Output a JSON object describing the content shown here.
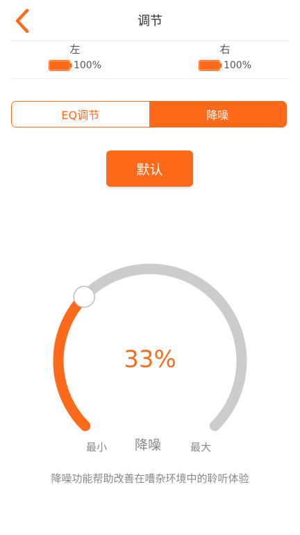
{
  "header": {
    "title": "调节"
  },
  "battery": {
    "left": {
      "side_label": "左",
      "percent_text": "100%",
      "level": 1.0
    },
    "right": {
      "side_label": "右",
      "percent_text": "100%",
      "level": 1.0
    }
  },
  "tabs": [
    {
      "label": "EQ调节",
      "active": false
    },
    {
      "label": "降噪",
      "active": true
    }
  ],
  "default_button": {
    "label": "默认"
  },
  "dial": {
    "value_percent": 33,
    "value_text": "33%",
    "min_label": "最小",
    "center_label": "降噪",
    "max_label": "最大"
  },
  "description": "降噪功能帮助改善在嘈杂环境中的聆听体验",
  "colors": {
    "accent": "#ff6a1a",
    "track": "#cccccc",
    "text_muted": "#888888"
  },
  "icons": {
    "back": "chevron-left-icon",
    "battery": "battery-icon"
  }
}
